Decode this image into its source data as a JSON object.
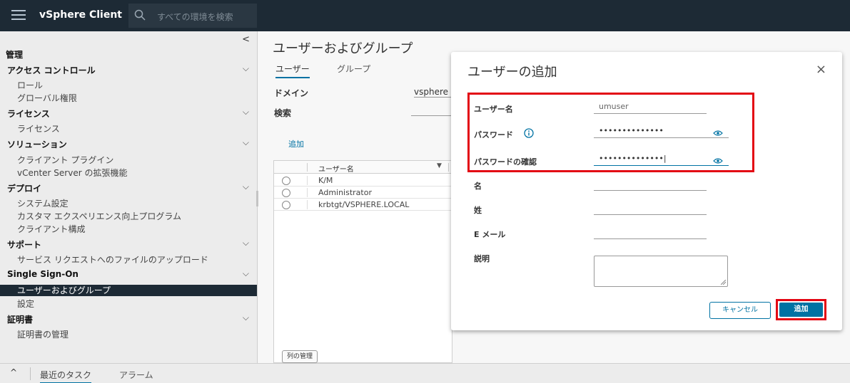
{
  "app": {
    "title": "vSphere Client"
  },
  "topbar": {
    "search_placeholder": "すべての環境を検索"
  },
  "sidebar": {
    "collapse": "<",
    "root": "管理",
    "sections": [
      {
        "label": "アクセス コントロール",
        "items": [
          "ロール",
          "グローバル権限"
        ]
      },
      {
        "label": "ライセンス",
        "items": [
          "ライセンス"
        ]
      },
      {
        "label": "ソリューション",
        "items": [
          "クライアント プラグイン",
          "vCenter Server の拡張機能"
        ]
      },
      {
        "label": "デプロイ",
        "items": [
          "システム設定",
          "カスタマ エクスペリエンス向上プログラム",
          "クライアント構成"
        ]
      },
      {
        "label": "サポート",
        "items": [
          "サービス リクエストへのファイルのアップロード"
        ]
      },
      {
        "label": "Single Sign-On",
        "items": [
          "ユーザーおよびグループ",
          "設定"
        ]
      },
      {
        "label": "証明書",
        "items": [
          "証明書の管理"
        ]
      }
    ],
    "selected_item": "ユーザーおよびグループ"
  },
  "main": {
    "title": "ユーザーおよびグループ",
    "tabs": [
      "ユーザー",
      "グループ"
    ],
    "domain_label": "ドメイン",
    "domain_value": "vsphere",
    "search_label": "検索",
    "add_link": "追加",
    "grid": {
      "column_header": "ユーザー名",
      "rows": [
        "K/M",
        "Administrator",
        "krbtgt/VSPHERE.LOCAL"
      ]
    },
    "column_manage_button": "列の管理"
  },
  "bottombar": {
    "expand": "^",
    "tabs": [
      "最近のタスク",
      "アラーム"
    ]
  },
  "modal": {
    "title": "ユーザーの追加",
    "close": "×",
    "fields": {
      "username_label": "ユーザー名",
      "username_value": "umuser",
      "password_label": "パスワード",
      "password_value": "••••••••••••••",
      "confirm_label": "パスワードの確認",
      "confirm_value": "••••••••••••••|",
      "first_name_label": "名",
      "last_name_label": "姓",
      "email_label": "E メール",
      "description_label": "説明"
    },
    "cancel_button": "キャンセル",
    "add_button": "追加"
  },
  "colors": {
    "topbar_bg": "#1d2a35",
    "accent": "#0072a3",
    "highlight": "#e30613"
  },
  "icons": [
    "menu-icon",
    "search-icon",
    "chevron-down-icon",
    "info-icon",
    "eye-icon",
    "close-icon",
    "sort-icon"
  ]
}
